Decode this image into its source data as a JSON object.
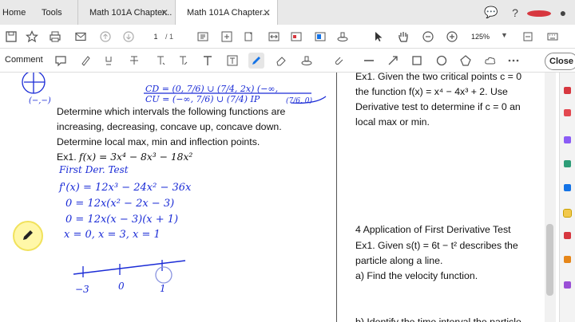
{
  "tabs": {
    "home": "Home",
    "tools": "Tools",
    "doc1": "Math 101A Chapter...",
    "doc2": "Math 101A Chapter..."
  },
  "toolbar": {
    "page_current": "1",
    "page_total": "/ 1",
    "zoom": "125%"
  },
  "commentbar": {
    "label": "Comment",
    "close_label": "Close"
  },
  "left_page": {
    "l1": "Determine which intervals the following functions are",
    "l2": "increasing, decreasing, concave up, concave down.",
    "l3": "Determine local max, min and inflection points.",
    "ex1_prefix": "Ex1.",
    "ex1_math": "f(x) = 3x⁴ − 8x³ − 18x²",
    "hw_top1": "CD = (0, 7/6) ∪ (7/4, 2x) (−∞,",
    "hw_top2": "CU = (−∞, 7/6) ∪ (7/4) IP",
    "hw_left": "(−,−)",
    "hw_ip": "(7/6, 0)",
    "hw1": "First Der. Test",
    "hw2": "f'(x) = 12x³ − 24x² − 36x",
    "hw3": "0 = 12x(x² − 2x − 3)",
    "hw4": "0 = 12x(x − 3)(x + 1)",
    "hw5": "x = 0,   x = 3,  x = 1",
    "nl1": "−3",
    "nl2": "0",
    "nl3": "1"
  },
  "right_page": {
    "r1": "Ex1. Given the two critical points c = 0",
    "r2": "the function f(x) = x⁴ − 4x³ + 2. Use",
    "r3": "Derivative test to determine if c = 0 an",
    "r4": "local max or min.",
    "r5": "4 Application of First Derivative Test",
    "r6": "Ex1. Given s(t) = 6t − t² describes the",
    "r7": "particle along a line.",
    "r8": "a) Find the velocity function.",
    "r9": "b) Identify the time interval the particle"
  },
  "colors": {
    "ink_blue": "#1a2bd6",
    "tab_active_bg": "#ffffff",
    "accent_blue": "#1473e6"
  }
}
